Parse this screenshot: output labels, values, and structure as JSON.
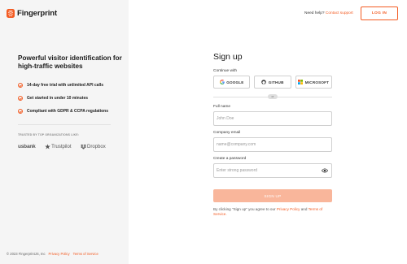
{
  "brand": {
    "name": "Fingerprint",
    "accent_color": "#f35b22"
  },
  "hero": {
    "title": "Powerful visitor identification for high-traffic websites",
    "features": [
      {
        "text": "14-day free trial with unlimited API calls",
        "icon": "check-circle-icon"
      },
      {
        "text": "Get started in under 10 minutes",
        "icon": "check-circle-icon"
      },
      {
        "text": "Compliant with GDPR & CCPA regulations",
        "icon": "check-circle-icon"
      }
    ]
  },
  "trusted": {
    "label": "TRUSTED BY TOP ORGANIZATIONS LIKE:",
    "logos": [
      "usbank",
      "Trustpilot",
      "Dropbox"
    ]
  },
  "header": {
    "help_text": "Need help?",
    "help_link": "Contact support",
    "login_label": "LOG IN"
  },
  "form": {
    "title": "Sign up",
    "continue_with": "Continue with",
    "sso": [
      "GOOGLE",
      "GITHUB",
      "MICROSOFT"
    ],
    "or_label": "or",
    "full_name": {
      "label": "Full name",
      "placeholder": "John Doe",
      "value": ""
    },
    "email": {
      "label": "Company email",
      "placeholder": "name@company.com",
      "value": ""
    },
    "password": {
      "label": "Create a password",
      "placeholder": "Enter strong password",
      "value": ""
    },
    "submit_label": "SIGN UP",
    "terms_prefix": "By clicking \"Sign up\" you agree to our",
    "privacy_link": "Privacy Policy",
    "terms_and": "and",
    "terms_link": "Terms of Service."
  },
  "footer": {
    "copyright": "© 2023 FingerprintJS, Inc",
    "privacy": "Privacy Policy",
    "terms": "Terms of Service"
  }
}
